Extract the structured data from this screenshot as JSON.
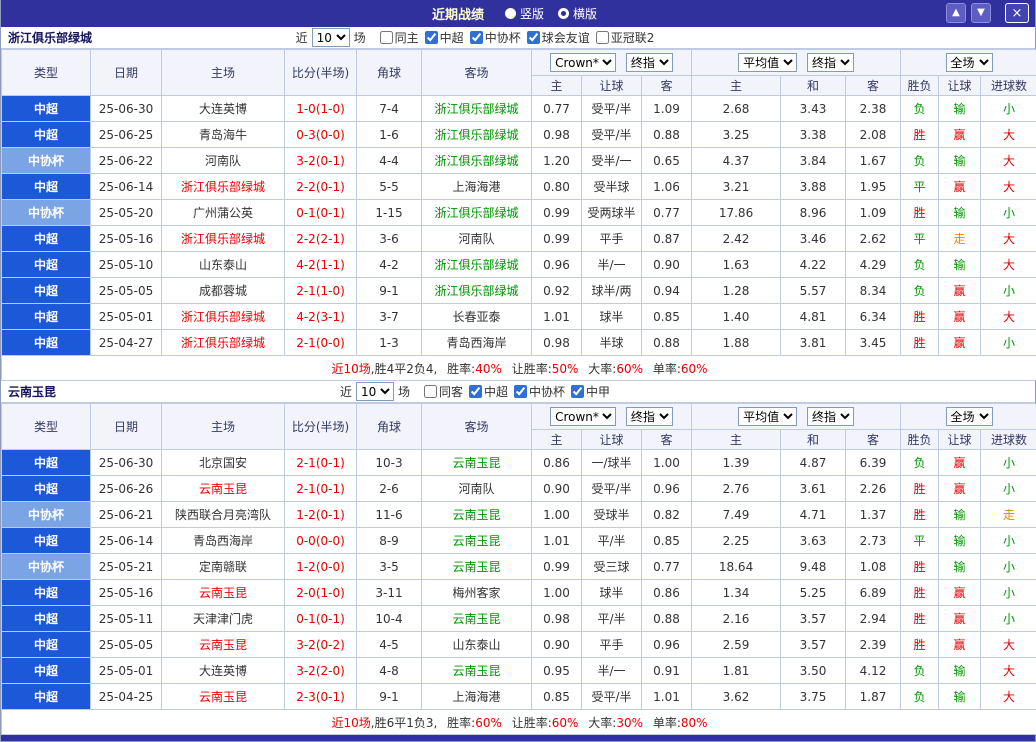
{
  "topbar": {
    "title": "近期战绩",
    "view_vertical": "竖版",
    "view_horizontal": "横版",
    "selected_view": "横版",
    "up_icon": "▲",
    "down_icon": "▼",
    "close_icon": "×"
  },
  "table_header": {
    "type": "类型",
    "date": "日期",
    "home": "主场",
    "score": "比分(半场)",
    "corner": "角球",
    "away": "客场",
    "odds_home": "主",
    "odds_let": "让球",
    "odds_away": "客",
    "avg_home": "主",
    "avg_draw": "和",
    "avg_away": "客",
    "result": "胜负",
    "let_result": "让球",
    "goals": "进球数",
    "bookmaker_select": "Crown*",
    "final_select": "终指",
    "average_select": "平均值",
    "final_select2": "终指",
    "scope_select": "全场"
  },
  "colors": {
    "topbar": "#31319e",
    "league_csl": "#1b59d8",
    "league_cup": "#7aa4e4",
    "win": "#e60000",
    "lose": "#009600",
    "push": "#e08a00"
  },
  "sections": [
    {
      "team": "浙江俱乐部绿城",
      "filter": {
        "near_label": "近",
        "count": "10",
        "games_label": "场",
        "checkboxes": [
          {
            "label": "同主",
            "checked": false
          },
          {
            "label": "中超",
            "checked": true
          },
          {
            "label": "中协杯",
            "checked": true
          },
          {
            "label": "球会友谊",
            "checked": true
          },
          {
            "label": "亚冠联2",
            "checked": false
          }
        ]
      },
      "rows": [
        {
          "league": "中超",
          "league_class": "csl",
          "date": "25-06-30",
          "home": "大连英博",
          "home_class": "",
          "score": "1-0(1-0)",
          "corner": "7-4",
          "away": "浙江俱乐部绿城",
          "away_class": "self-away",
          "odds_home": "0.77",
          "handicap": "受平/半",
          "odds_away": "1.09",
          "avg_home": "2.68",
          "avg_draw": "3.43",
          "avg_away": "2.38",
          "result": "负",
          "result_class": "lose",
          "let_result": "输",
          "let_class": "lose",
          "goals": "小",
          "goals_class": "lose"
        },
        {
          "league": "中超",
          "league_class": "csl",
          "date": "25-06-25",
          "home": "青岛海牛",
          "home_class": "",
          "score": "0-3(0-0)",
          "corner": "1-6",
          "away": "浙江俱乐部绿城",
          "away_class": "self-away",
          "odds_home": "0.98",
          "handicap": "受平/半",
          "odds_away": "0.88",
          "avg_home": "3.25",
          "avg_draw": "3.38",
          "avg_away": "2.08",
          "result": "胜",
          "result_class": "win",
          "let_result": "赢",
          "let_class": "win",
          "goals": "大",
          "goals_class": "win"
        },
        {
          "league": "中协杯",
          "league_class": "cup",
          "date": "25-06-22",
          "home": "河南队",
          "home_class": "",
          "score": "3-2(0-1)",
          "corner": "4-4",
          "away": "浙江俱乐部绿城",
          "away_class": "self-away",
          "odds_home": "1.20",
          "handicap": "受半/一",
          "odds_away": "0.65",
          "avg_home": "4.37",
          "avg_draw": "3.84",
          "avg_away": "1.67",
          "result": "负",
          "result_class": "lose",
          "let_result": "输",
          "let_class": "lose",
          "goals": "大",
          "goals_class": "win"
        },
        {
          "league": "中超",
          "league_class": "csl",
          "date": "25-06-14",
          "home": "浙江俱乐部绿城",
          "home_class": "self-home",
          "score": "2-2(0-1)",
          "corner": "5-5",
          "away": "上海海港",
          "away_class": "",
          "odds_home": "0.80",
          "handicap": "受半球",
          "odds_away": "1.06",
          "avg_home": "3.21",
          "avg_draw": "3.88",
          "avg_away": "1.95",
          "result": "平",
          "result_class": "draw",
          "let_result": "赢",
          "let_class": "win",
          "goals": "大",
          "goals_class": "win"
        },
        {
          "league": "中协杯",
          "league_class": "cup",
          "date": "25-05-20",
          "home": "广州蒲公英",
          "home_class": "",
          "score": "0-1(0-1)",
          "corner": "1-15",
          "away": "浙江俱乐部绿城",
          "away_class": "self-away",
          "odds_home": "0.99",
          "handicap": "受两球半",
          "odds_away": "0.77",
          "avg_home": "17.86",
          "avg_draw": "8.96",
          "avg_away": "1.09",
          "result": "胜",
          "result_class": "win",
          "let_result": "输",
          "let_class": "lose",
          "goals": "小",
          "goals_class": "lose"
        },
        {
          "league": "中超",
          "league_class": "csl",
          "date": "25-05-16",
          "home": "浙江俱乐部绿城",
          "home_class": "self-home",
          "score": "2-2(2-1)",
          "corner": "3-6",
          "away": "河南队",
          "away_class": "",
          "odds_home": "0.99",
          "handicap": "平手",
          "odds_away": "0.87",
          "avg_home": "2.42",
          "avg_draw": "3.46",
          "avg_away": "2.62",
          "result": "平",
          "result_class": "draw",
          "let_result": "走",
          "let_class": "push",
          "goals": "大",
          "goals_class": "win"
        },
        {
          "league": "中超",
          "league_class": "csl",
          "date": "25-05-10",
          "home": "山东泰山",
          "home_class": "",
          "score": "4-2(1-1)",
          "corner": "4-2",
          "away": "浙江俱乐部绿城",
          "away_class": "self-away",
          "odds_home": "0.96",
          "handicap": "半/一",
          "odds_away": "0.90",
          "avg_home": "1.63",
          "avg_draw": "4.22",
          "avg_away": "4.29",
          "result": "负",
          "result_class": "lose",
          "let_result": "输",
          "let_class": "lose",
          "goals": "大",
          "goals_class": "win"
        },
        {
          "league": "中超",
          "league_class": "csl",
          "date": "25-05-05",
          "home": "成都蓉城",
          "home_class": "",
          "score": "2-1(1-0)",
          "corner": "9-1",
          "away": "浙江俱乐部绿城",
          "away_class": "self-away",
          "odds_home": "0.92",
          "handicap": "球半/两",
          "odds_away": "0.94",
          "avg_home": "1.28",
          "avg_draw": "5.57",
          "avg_away": "8.34",
          "result": "负",
          "result_class": "lose",
          "let_result": "赢",
          "let_class": "win",
          "goals": "小",
          "goals_class": "lose"
        },
        {
          "league": "中超",
          "league_class": "csl",
          "date": "25-05-01",
          "home": "浙江俱乐部绿城",
          "home_class": "self-home",
          "score": "4-2(3-1)",
          "corner": "3-7",
          "away": "长春亚泰",
          "away_class": "",
          "odds_home": "1.01",
          "handicap": "球半",
          "odds_away": "0.85",
          "avg_home": "1.40",
          "avg_draw": "4.81",
          "avg_away": "6.34",
          "result": "胜",
          "result_class": "win",
          "let_result": "赢",
          "let_class": "win",
          "goals": "大",
          "goals_class": "win"
        },
        {
          "league": "中超",
          "league_class": "csl",
          "date": "25-04-27",
          "home": "浙江俱乐部绿城",
          "home_class": "self-home",
          "score": "2-1(0-0)",
          "corner": "1-3",
          "away": "青岛西海岸",
          "away_class": "",
          "odds_home": "0.98",
          "handicap": "半球",
          "odds_away": "0.88",
          "avg_home": "1.88",
          "avg_draw": "3.81",
          "avg_away": "3.45",
          "result": "胜",
          "result_class": "win",
          "let_result": "赢",
          "let_class": "win",
          "goals": "小",
          "goals_class": "lose"
        }
      ],
      "summary": {
        "recent": "近10场",
        "record": ",胜4平2负4,",
        "win_rate_label": "胜率:",
        "win_rate": "40%",
        "let_rate_label": "让胜率:",
        "let_rate": "50%",
        "big_rate_label": "大率:",
        "big_rate": "60%",
        "single_rate_label": "单率:",
        "single_rate": "60%"
      }
    },
    {
      "team": "云南玉昆",
      "filter": {
        "near_label": "近",
        "count": "10",
        "games_label": "场",
        "checkboxes": [
          {
            "label": "同客",
            "checked": false
          },
          {
            "label": "中超",
            "checked": true
          },
          {
            "label": "中协杯",
            "checked": true
          },
          {
            "label": "中甲",
            "checked": true
          }
        ]
      },
      "rows": [
        {
          "league": "中超",
          "league_class": "csl",
          "date": "25-06-30",
          "home": "北京国安",
          "home_class": "",
          "score": "2-1(0-1)",
          "corner": "10-3",
          "away": "云南玉昆",
          "away_class": "self-away",
          "odds_home": "0.86",
          "handicap": "一/球半",
          "odds_away": "1.00",
          "avg_home": "1.39",
          "avg_draw": "4.87",
          "avg_away": "6.39",
          "result": "负",
          "result_class": "lose",
          "let_result": "赢",
          "let_class": "win",
          "goals": "小",
          "goals_class": "lose"
        },
        {
          "league": "中超",
          "league_class": "csl",
          "date": "25-06-26",
          "home": "云南玉昆",
          "home_class": "self-home",
          "score": "2-1(0-1)",
          "corner": "2-6",
          "away": "河南队",
          "away_class": "",
          "odds_home": "0.90",
          "handicap": "受平/半",
          "odds_away": "0.96",
          "avg_home": "2.76",
          "avg_draw": "3.61",
          "avg_away": "2.26",
          "result": "胜",
          "result_class": "win",
          "let_result": "赢",
          "let_class": "win",
          "goals": "小",
          "goals_class": "lose"
        },
        {
          "league": "中协杯",
          "league_class": "cup",
          "date": "25-06-21",
          "home": "陕西联合月亮湾队",
          "home_class": "",
          "score": "1-2(0-1)",
          "corner": "11-6",
          "away": "云南玉昆",
          "away_class": "self-away",
          "odds_home": "1.00",
          "handicap": "受球半",
          "odds_away": "0.82",
          "avg_home": "7.49",
          "avg_draw": "4.71",
          "avg_away": "1.37",
          "result": "胜",
          "result_class": "win",
          "let_result": "输",
          "let_class": "lose",
          "goals": "走",
          "goals_class": "push"
        },
        {
          "league": "中超",
          "league_class": "csl",
          "date": "25-06-14",
          "home": "青岛西海岸",
          "home_class": "",
          "score": "0-0(0-0)",
          "corner": "8-9",
          "away": "云南玉昆",
          "away_class": "self-away",
          "odds_home": "1.01",
          "handicap": "平/半",
          "odds_away": "0.85",
          "avg_home": "2.25",
          "avg_draw": "3.63",
          "avg_away": "2.73",
          "result": "平",
          "result_class": "draw",
          "let_result": "输",
          "let_class": "lose",
          "goals": "小",
          "goals_class": "lose"
        },
        {
          "league": "中协杯",
          "league_class": "cup",
          "date": "25-05-21",
          "home": "定南赣联",
          "home_class": "",
          "score": "1-2(0-0)",
          "corner": "3-5",
          "away": "云南玉昆",
          "away_class": "self-away",
          "odds_home": "0.99",
          "handicap": "受三球",
          "odds_away": "0.77",
          "avg_home": "18.64",
          "avg_draw": "9.48",
          "avg_away": "1.08",
          "result": "胜",
          "result_class": "win",
          "let_result": "输",
          "let_class": "lose",
          "goals": "小",
          "goals_class": "lose"
        },
        {
          "league": "中超",
          "league_class": "csl",
          "date": "25-05-16",
          "home": "云南玉昆",
          "home_class": "self-home",
          "score": "2-0(1-0)",
          "corner": "3-11",
          "away": "梅州客家",
          "away_class": "",
          "odds_home": "1.00",
          "handicap": "球半",
          "odds_away": "0.86",
          "avg_home": "1.34",
          "avg_draw": "5.25",
          "avg_away": "6.89",
          "result": "胜",
          "result_class": "win",
          "let_result": "赢",
          "let_class": "win",
          "goals": "小",
          "goals_class": "lose"
        },
        {
          "league": "中超",
          "league_class": "csl",
          "date": "25-05-11",
          "home": "天津津门虎",
          "home_class": "",
          "score": "0-1(0-1)",
          "corner": "10-4",
          "away": "云南玉昆",
          "away_class": "self-away",
          "odds_home": "0.98",
          "handicap": "平/半",
          "odds_away": "0.88",
          "avg_home": "2.16",
          "avg_draw": "3.57",
          "avg_away": "2.94",
          "result": "胜",
          "result_class": "win",
          "let_result": "赢",
          "let_class": "win",
          "goals": "小",
          "goals_class": "lose"
        },
        {
          "league": "中超",
          "league_class": "csl",
          "date": "25-05-05",
          "home": "云南玉昆",
          "home_class": "self-home",
          "score": "3-2(0-2)",
          "corner": "4-5",
          "away": "山东泰山",
          "away_class": "",
          "odds_home": "0.90",
          "handicap": "平手",
          "odds_away": "0.96",
          "avg_home": "2.59",
          "avg_draw": "3.57",
          "avg_away": "2.39",
          "result": "胜",
          "result_class": "win",
          "let_result": "赢",
          "let_class": "win",
          "goals": "大",
          "goals_class": "win"
        },
        {
          "league": "中超",
          "league_class": "csl",
          "date": "25-05-01",
          "home": "大连英博",
          "home_class": "",
          "score": "3-2(2-0)",
          "corner": "4-8",
          "away": "云南玉昆",
          "away_class": "self-away",
          "odds_home": "0.95",
          "handicap": "半/一",
          "odds_away": "0.91",
          "avg_home": "1.81",
          "avg_draw": "3.50",
          "avg_away": "4.12",
          "result": "负",
          "result_class": "lose",
          "let_result": "输",
          "let_class": "lose",
          "goals": "大",
          "goals_class": "win"
        },
        {
          "league": "中超",
          "league_class": "csl",
          "date": "25-04-25",
          "home": "云南玉昆",
          "home_class": "self-home",
          "score": "2-3(0-1)",
          "corner": "9-1",
          "away": "上海海港",
          "away_class": "",
          "odds_home": "0.85",
          "handicap": "受平/半",
          "odds_away": "1.01",
          "avg_home": "3.62",
          "avg_draw": "3.75",
          "avg_away": "1.87",
          "result": "负",
          "result_class": "lose",
          "let_result": "输",
          "let_class": "lose",
          "goals": "大",
          "goals_class": "win"
        }
      ],
      "summary": {
        "recent": "近10场",
        "record": ",胜6平1负3,",
        "win_rate_label": "胜率:",
        "win_rate": "60%",
        "let_rate_label": "让胜率:",
        "let_rate": "60%",
        "big_rate_label": "大率:",
        "big_rate": "30%",
        "single_rate_label": "单率:",
        "single_rate": "80%"
      }
    }
  ]
}
